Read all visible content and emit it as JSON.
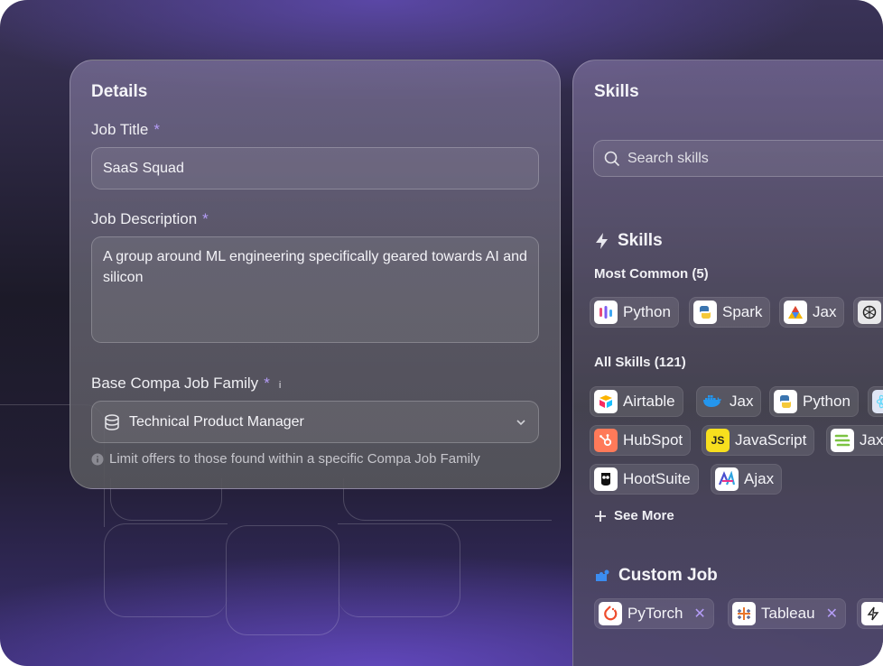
{
  "details": {
    "title": "Details",
    "job_title_label": "Job Title",
    "job_title_value": "SaaS Squad",
    "job_description_label": "Job Description",
    "job_description_value": "A group around ML engineering specifically geared towards AI and silicon",
    "job_family_label": "Base Compa Job Family",
    "job_family_value": "Technical Product Manager",
    "job_family_hint": "Limit offers to those found within a specific Compa Job Family",
    "required_marker": "*",
    "info_marker": "i"
  },
  "skills_panel": {
    "title": "Skills",
    "search_placeholder": "Search skills",
    "skills_heading": "Skills",
    "most_common_label": "Most Common (5)",
    "most_common": [
      {
        "label": "Python",
        "icon": "python-icon"
      },
      {
        "label": "Spark",
        "icon": "spark-icon"
      },
      {
        "label": "Jax",
        "icon": "jax-icon"
      },
      {
        "label": "",
        "icon": "openai-icon"
      }
    ],
    "all_skills_label": "All Skills (121)",
    "all_skills": [
      {
        "label": "Airtable",
        "icon": "airtable-icon"
      },
      {
        "label": "Jax",
        "icon": "docker-icon"
      },
      {
        "label": "Python",
        "icon": "python-icon"
      },
      {
        "label": "",
        "icon": "react-icon"
      },
      {
        "label": "HubSpot",
        "icon": "hubspot-icon"
      },
      {
        "label": "JavaScript",
        "icon": "javascript-icon"
      },
      {
        "label": "Jax",
        "icon": "jax-icon"
      },
      {
        "label": "HootSuite",
        "icon": "hootsuite-icon"
      },
      {
        "label": "Ajax",
        "icon": "ajax-icon"
      }
    ],
    "javascript_badge": "JS",
    "see_more_label": "See More",
    "custom_job_heading": "Custom Job",
    "custom_job": [
      {
        "label": "PyTorch",
        "icon": "pytorch-icon"
      },
      {
        "label": "Tableau",
        "icon": "tableau-icon"
      },
      {
        "label": "",
        "icon": "zapier-icon"
      }
    ],
    "remove_glyph": "✕"
  },
  "colors": {
    "accent": "#b49cf6",
    "background": "#1c1a28",
    "hubspot": "#ff7a59",
    "javascript": "#f7df1e",
    "pytorch": "#ee4c2c"
  }
}
